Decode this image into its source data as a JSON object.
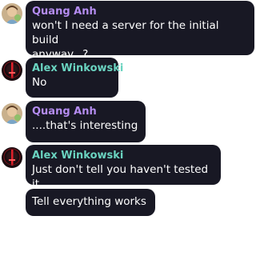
{
  "colors": {
    "bubble_bg": "#181824",
    "message_text": "#ffffff",
    "author_quang": "#b48cf0",
    "author_alex": "#6ad3c0"
  },
  "messages": [
    {
      "author": "Quang Anh",
      "avatar_icon": "quang-anh-avatar-icon",
      "lines": [
        "won't I need a server for the initial build",
        "anyway...?"
      ]
    },
    {
      "author": "Alex Winkowski",
      "avatar_icon": "alex-winkowski-avatar-icon",
      "lines": [
        "No"
      ]
    },
    {
      "author": "Quang Anh",
      "avatar_icon": "quang-anh-avatar-icon",
      "lines": [
        "....that's interesting"
      ]
    },
    {
      "author": "Alex Winkowski",
      "avatar_icon": "alex-winkowski-avatar-icon",
      "lines": [
        "Just don't tell you haven't tested it"
      ]
    },
    {
      "author": "",
      "lines": [
        "Tell everything works"
      ]
    }
  ]
}
